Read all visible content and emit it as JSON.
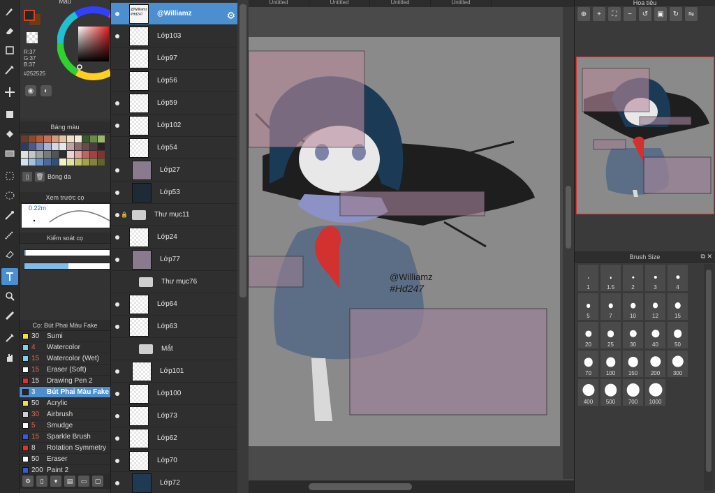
{
  "tabs": [
    "Untitled",
    "Untitled",
    "Untitled",
    "Untitled"
  ],
  "color_panel": {
    "title": "Màu",
    "r": "R:37",
    "g": "G:37",
    "b": "B:37",
    "hex": "#252525",
    "current_color": "#252525",
    "secondary_color": "#6a3a1a"
  },
  "palette_panel": {
    "title": "Bảng màu",
    "shadow_label": "Bóng da",
    "swatches": [
      "#6b3a2a",
      "#8a4b2a",
      "#b45a3a",
      "#c8705a",
      "#d49a7a",
      "#e6c2a2",
      "#f2dcc4",
      "#f4e8d8",
      "#3a5a2a",
      "#6a8a4a",
      "#9ab66a",
      "#2a3a6a",
      "#4a5a8a",
      "#7a8ab6",
      "#a6b2d6",
      "#d2d6e6",
      "#e6e8f0",
      "#c2a2a2",
      "#8a6a6a",
      "#6a4a4a",
      "#4a3a3a",
      "#2a2222",
      "#e0e0e0",
      "#c6c6c6",
      "#a0a0a0",
      "#7a7a7a",
      "#545454",
      "#2e2e2e",
      "#f2d2d2",
      "#e2a2a2",
      "#c26262",
      "#a24242",
      "#823232",
      "#d2e2f2",
      "#a2c2e2",
      "#6a92c2",
      "#4a6a9a",
      "#34507a",
      "#f2f2c2",
      "#e2e2a2",
      "#c2c26a",
      "#a2a24a",
      "#82823a",
      "#62622a"
    ]
  },
  "preview_panel": {
    "title": "Xem trước cọ",
    "size": "0.22m"
  },
  "control_panel": {
    "title": "Kiểm soát cọ",
    "slider1": 0.02,
    "slider2": 0.52
  },
  "brush_panel": {
    "title": "Cọ: Bút Phai Màu Fake",
    "brushes": [
      {
        "size": "30",
        "name": "Sumi",
        "color": "#f0e040",
        "dim": false
      },
      {
        "size": "4",
        "name": "Watercolor",
        "color": "#7ad2ef",
        "dim": true
      },
      {
        "size": "15",
        "name": "Watercolor (Wet)",
        "color": "#7ad2ef",
        "dim": true
      },
      {
        "size": "15",
        "name": "Eraser (Soft)",
        "color": "#ffffff",
        "dim": true
      },
      {
        "size": "15",
        "name": "Drawing Pen 2",
        "color": "#e03030",
        "dim": false
      },
      {
        "size": "3",
        "name": "Bút Phai Màu Fake",
        "color": "#252525",
        "dim": false
      },
      {
        "size": "50",
        "name": "Acrylic",
        "color": "#f0e040",
        "dim": false
      },
      {
        "size": "30",
        "name": "Airbrush",
        "color": "#cfcfcf",
        "dim": true
      },
      {
        "size": "5",
        "name": "Smudge",
        "color": "#ffffff",
        "dim": true
      },
      {
        "size": "15",
        "name": "Sparkle Brush",
        "color": "#3a5ad2",
        "dim": true
      },
      {
        "size": "8",
        "name": "Rotation Symmetry",
        "color": "#e03030",
        "dim": false
      },
      {
        "size": "50",
        "name": "Eraser",
        "color": "#ffffff",
        "dim": false
      },
      {
        "size": "200",
        "name": "Paint 2",
        "color": "#3a5ad2",
        "dim": false
      }
    ]
  },
  "layers": [
    {
      "name": "@Williamz",
      "type": "layer",
      "selected": true,
      "visible": true,
      "thumb_text": "@Williamz #Hd247",
      "indent": false
    },
    {
      "name": "Lớp103",
      "type": "layer",
      "visible": true,
      "indent": false
    },
    {
      "name": "Lớp97",
      "type": "layer",
      "visible": false,
      "indent": false
    },
    {
      "name": "Lớp56",
      "type": "layer",
      "visible": false,
      "indent": false
    },
    {
      "name": "Lớp59",
      "type": "layer",
      "visible": true,
      "indent": false
    },
    {
      "name": "Lớp102",
      "type": "layer",
      "visible": true,
      "indent": false
    },
    {
      "name": "Lớp54",
      "type": "layer",
      "visible": false,
      "indent": false
    },
    {
      "name": "Lớp27",
      "type": "layer",
      "visible": true,
      "indent": true,
      "thumb_color": "#8a7a8e"
    },
    {
      "name": "Lớp53",
      "type": "layer",
      "visible": true,
      "indent": true,
      "thumb_color": "#1e2a36"
    },
    {
      "name": "Thư mục11",
      "type": "folder",
      "visible": true,
      "locked": true
    },
    {
      "name": "Lớp24",
      "type": "layer",
      "visible": true,
      "indent": false
    },
    {
      "name": "Lớp77",
      "type": "layer",
      "visible": true,
      "indent": true,
      "thumb_color": "#8a7a8e"
    },
    {
      "name": "Thư mục76",
      "type": "folder",
      "visible": false
    },
    {
      "name": "Lớp64",
      "type": "layer",
      "visible": true,
      "indent": false
    },
    {
      "name": "Lớp63",
      "type": "layer",
      "visible": true,
      "indent": false
    },
    {
      "name": "Mắt",
      "type": "folder",
      "visible": false
    },
    {
      "name": "Lớp101",
      "type": "layer",
      "visible": true,
      "indent": true
    },
    {
      "name": "Lớp100",
      "type": "layer",
      "visible": true,
      "indent": false
    },
    {
      "name": "Lớp73",
      "type": "layer",
      "visible": true,
      "indent": false
    },
    {
      "name": "Lớp62",
      "type": "layer",
      "visible": true,
      "indent": false
    },
    {
      "name": "Lớp70",
      "type": "layer",
      "visible": true,
      "indent": false
    },
    {
      "name": "Lớp72",
      "type": "layer",
      "visible": true,
      "indent": true,
      "thumb_color": "#1f3a55"
    }
  ],
  "canvas": {
    "signature_line1": "@Williamz",
    "signature_line2": "#Hd247"
  },
  "navigator": {
    "title": "Hoa tiêu"
  },
  "brush_size_panel": {
    "title": "Brush Size",
    "sizes": [
      "1",
      "1.5",
      "2",
      "3",
      "4",
      "5",
      "7",
      "10",
      "12",
      "15",
      "20",
      "25",
      "30",
      "40",
      "50",
      "70",
      "100",
      "150",
      "200",
      "300",
      "400",
      "500",
      "700",
      "1000"
    ]
  }
}
